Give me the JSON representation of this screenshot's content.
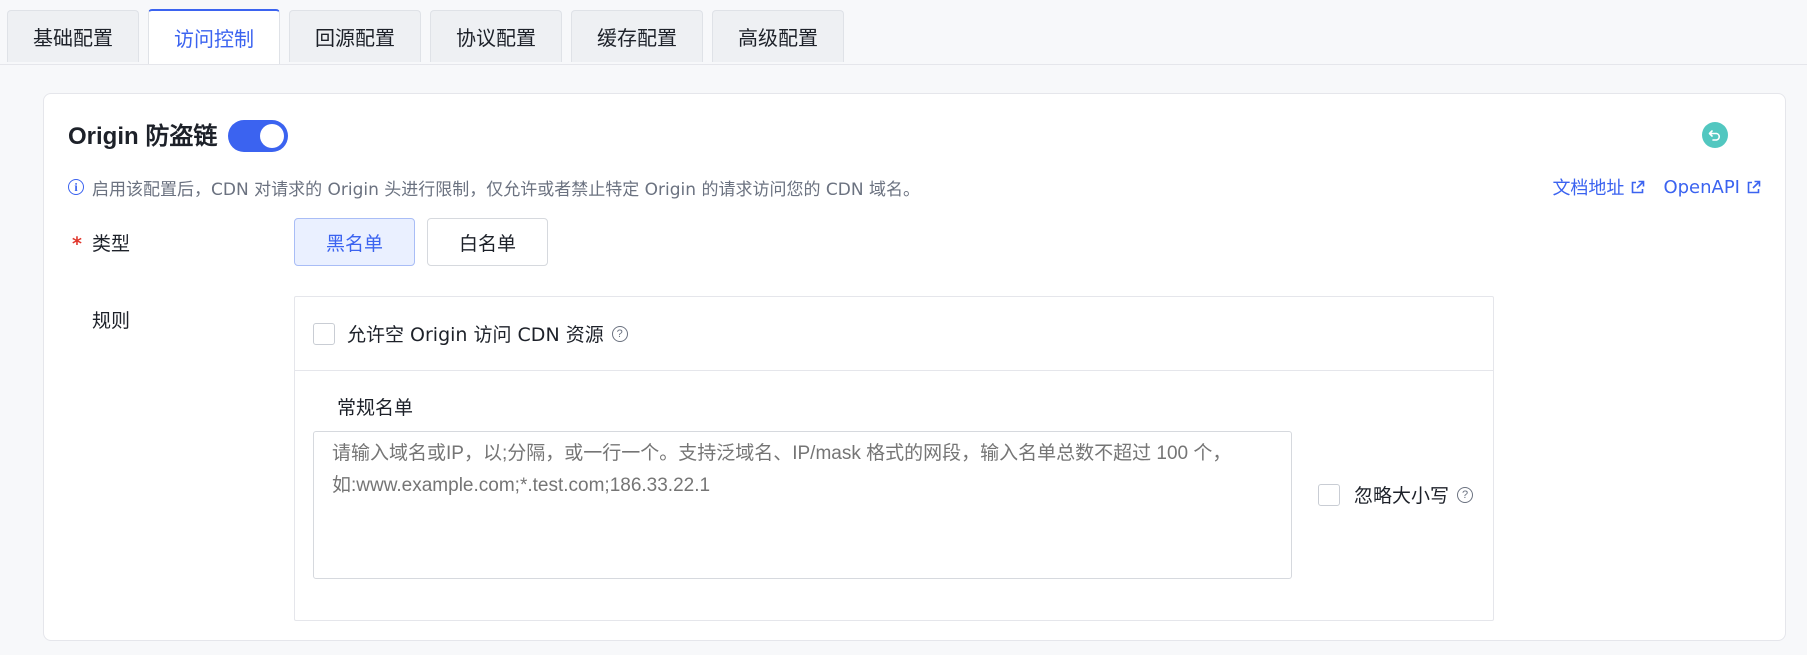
{
  "tabs": [
    {
      "label": "基础配置",
      "active": false
    },
    {
      "label": "访问控制",
      "active": true
    },
    {
      "label": "回源配置",
      "active": false
    },
    {
      "label": "协议配置",
      "active": false
    },
    {
      "label": "缓存配置",
      "active": false
    },
    {
      "label": "高级配置",
      "active": false
    }
  ],
  "section": {
    "title": "Origin 防盗链",
    "enabled": true,
    "info_text": "启用该配置后，CDN 对请求的 Origin 头进行限制，仅允许或者禁止特定 Origin 的请求访问您的 CDN 域名。",
    "links": {
      "docs": "文档地址",
      "openapi": "OpenAPI"
    }
  },
  "type_field": {
    "required_mark": "*",
    "label": "类型",
    "options": [
      "黑名单",
      "白名单"
    ],
    "selected": "黑名单"
  },
  "rules_field": {
    "label": "规则",
    "allow_empty_label": "允许空 Origin 访问 CDN 资源",
    "allow_empty_checked": false,
    "list_title": "常规名单",
    "textarea_value": "",
    "textarea_placeholder": "请输入域名或IP，以;分隔，或一行一个。支持泛域名、IP/mask 格式的网段，输入名单总数不超过 100 个，如:www.example.com;*.test.com;186.33.22.1",
    "ignore_case_label": "忽略大小写",
    "ignore_case_checked": false
  },
  "colors": {
    "accent": "#3b63f0",
    "reset_icon": "#52c7c0",
    "required": "#e0352b"
  },
  "icons": {
    "info": "info-icon",
    "external_link": "external-link-icon",
    "help": "help-icon",
    "reset": "reset-icon"
  }
}
